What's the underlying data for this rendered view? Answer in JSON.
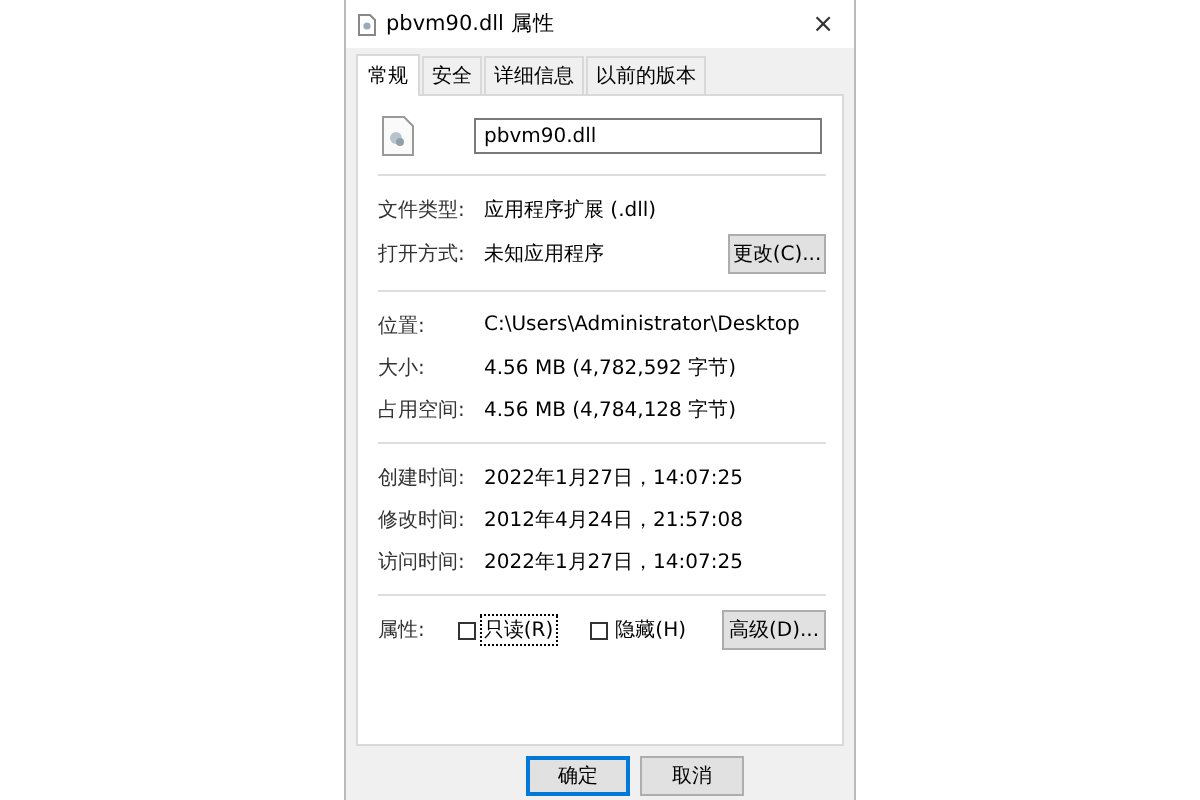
{
  "window": {
    "title": "pbvm90.dll 属性",
    "close": "×"
  },
  "tabs": [
    {
      "label": "常规",
      "selected": true
    },
    {
      "label": "安全",
      "selected": false
    },
    {
      "label": "详细信息",
      "selected": false
    },
    {
      "label": "以前的版本",
      "selected": false
    }
  ],
  "file_name": {
    "value": "pbvm90.dll"
  },
  "sections": [
    {
      "rows": [
        {
          "label": "文件类型:",
          "value": "应用程序扩展 (.dll)"
        },
        {
          "label": "打开方式:",
          "value": "未知应用程序",
          "button": "更改(C)..."
        }
      ]
    },
    {
      "rows": [
        {
          "label": "位置:",
          "value": "C:\\Users\\Administrator\\Desktop"
        },
        {
          "label": "大小:",
          "value": "4.56 MB (4,782,592 字节)"
        },
        {
          "label": "占用空间:",
          "value": "4.56 MB (4,784,128 字节)"
        }
      ]
    },
    {
      "rows": [
        {
          "label": "创建时间:",
          "value": "2022年1月27日，14:07:25"
        },
        {
          "label": "修改时间:",
          "value": "2012年4月24日，21:57:08"
        },
        {
          "label": "访问时间:",
          "value": "2022年1月27日，14:07:25"
        }
      ]
    }
  ],
  "attributes": {
    "label": "属性:",
    "checkboxes": [
      {
        "label": "只读(R)",
        "checked": false,
        "focused": true
      },
      {
        "label": "隐藏(H)",
        "checked": false,
        "focused": false
      }
    ],
    "button": "高级(D)..."
  },
  "buttons": [
    {
      "label": "确定",
      "default": true
    },
    {
      "label": "取消",
      "default": false
    }
  ]
}
